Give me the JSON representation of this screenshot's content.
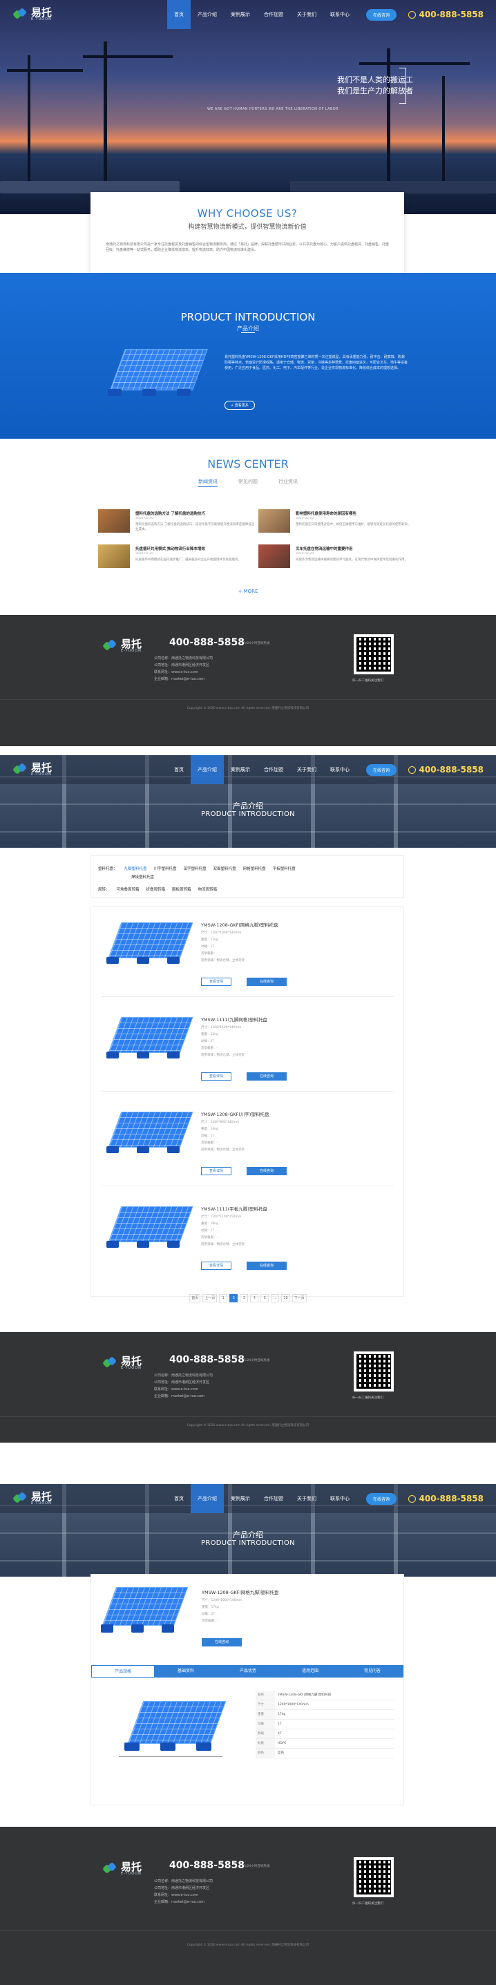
{
  "nav": {
    "logo_cn": "易托",
    "logo_en": "E-TUOON",
    "items": [
      "首页",
      "产品介绍",
      "案例展示",
      "合作加盟",
      "关于我们",
      "联系中心"
    ],
    "active": 0,
    "button": "在线咨询",
    "phone": "400-888-5858"
  },
  "hero": {
    "line1": "我们不是人类的搬运工",
    "line2": "我们是生产力的解放者",
    "line3": "WE ARE NOT HUMAN PORTERS WE ARE THE LIBERATION OF LABOR"
  },
  "why": {
    "title": "WHY CHOOSE US?",
    "subtitle": "构建智慧物流新模式，提供智慧物流新价值",
    "body": "南通托之物流科技有限公司是一家专注托盘租赁及托盘销售的综合型物流服务商。通过「易托」品牌，深耕托盘循环共用业务，以共享托盘为核心，为客户提供托盘租赁、托盘销售、托盘回收、托盘维修等一站式服务，帮助企业降低物流成本、提升物流效率，助力中国物流标准化建设。"
  },
  "product": {
    "title": "PRODUCT INTRODUCTION",
    "subtitle": "产品介绍",
    "desc": "易托塑料托盘YMSW-1208-GKF采用HDPE高密度聚乙烯材质一次注塑成型，具有承重能力强、耐冲击、耐腐蚀、防潮防霉等特点，表面设计防滑纹路，适用于仓储、物流、货架、冷链等多种场景。托盘四面进叉，可配合叉车、地牛等设备使用，广泛应用于食品、医药、化工、电子、汽车配件等行业，是企业实现物流标准化、降低综合成本的理想选择。",
    "more": "+ 查看更多"
  },
  "news": {
    "title": "NEWS CENTER",
    "tabs": [
      "新闻资讯",
      "常见问题",
      "行业资讯"
    ],
    "active": 0,
    "items": [
      {
        "title": "塑料托盘的选购方法 了解托盘的选购技巧",
        "date": "2020-02-20",
        "desc": "塑料托盘的选购方法 了解托盘的选购技巧，选对托盘不仅能够提升物流效率还能降低企业成本。"
      },
      {
        "title": "影响塑料托盘使用寿命的原因有哪些",
        "date": "2020-02-20",
        "desc": "塑料托盘在日常使用过程中，如何正确使用与维护，能够有效延长托盘的使用寿命。"
      },
      {
        "title": "托盘循环共用模式 推动物流行业降本增效",
        "date": "2020-02-20",
        "desc": "托盘循环共用模式在国内逐步推广，越来越多的企业开始使用共享托盘服务。"
      },
      {
        "title": "叉车托盘在物流运输中的重要作用",
        "date": "2020-02-20",
        "desc": "托盘作为物流运输中重要的集装单元器具，在现代物流中发挥着举足轻重的作用。"
      }
    ],
    "more": "+ MORE"
  },
  "footer": {
    "phone": "400-888-5858",
    "hours": "7x24小时咨询热线",
    "addr": [
      "公司名称：南通托之物流科技有限公司",
      "公司地址：南通市港闸区经济开发区",
      "联系网址：www.e-tuo.com",
      "企业邮箱：market@e-tuo.com"
    ],
    "qr": "扫一扫二维码关注我们",
    "copy": "Copyright © 2020 www.e-tuo.com All rights reserved. 南通托之物流科技有限公司"
  },
  "banner": {
    "title": "产品介绍",
    "en": "PRODUCT INTRODUCTION"
  },
  "filter": {
    "label1": "塑料托盘：",
    "opts1": [
      "九脚塑料托盘",
      "川字塑料托盘",
      "田字塑料托盘",
      "双面塑料托盘",
      "网格塑料托盘",
      "平板塑料托盘",
      "焊接塑料托盘"
    ],
    "label2": "周转：",
    "opts2": [
      "可堆叠周转箱",
      "折叠周转箱",
      "围板周转箱",
      "物流周转箱"
    ]
  },
  "list": {
    "items": [
      {
        "name": "YMSW-1208-GKF(网格九脚)塑料托盘",
        "size": "尺寸：1200*1000*140mm",
        "weight": "重量：17kg",
        "load": "动载：1T",
        "rack": "货架载重：-",
        "desc": "适用领域：物流仓储、立体货架",
        "btn1": "查看详情",
        "btn2": "在线咨询"
      },
      {
        "name": "YMSW-1111(九脚网格)塑料托盘",
        "size": "尺寸：1100*1100*140mm",
        "weight": "重量：15kg",
        "load": "动载：1T",
        "rack": "货架载重：-",
        "desc": "适用领域：物流仓储、立体货架",
        "btn1": "查看详情",
        "btn2": "在线咨询"
      },
      {
        "name": "YMSW-1208-GKF(川字)塑料托盘",
        "size": "尺寸：1200*800*140mm",
        "weight": "重量：14kg",
        "load": "动载：1T",
        "rack": "货架载重：-",
        "desc": "适用领域：物流仓储、立体货架",
        "btn1": "查看详情",
        "btn2": "在线咨询"
      },
      {
        "name": "YMSW-1111(平板九脚)塑料托盘",
        "size": "尺寸：1100*1100*150mm",
        "weight": "重量：16kg",
        "load": "动载：1T",
        "rack": "货架载重：-",
        "desc": "适用领域：物流仓储、立体货架",
        "btn1": "查看详情",
        "btn2": "在线咨询"
      }
    ]
  },
  "pager": [
    "首页",
    "上一页",
    "1",
    "2",
    "3",
    "4",
    "5",
    "…",
    "20",
    "下一页"
  ],
  "detail": {
    "name": "YMSW-1208-GKF(网格九脚)塑料托盘",
    "size": "尺寸：1200*1000*140mm",
    "weight": "重量：17kg",
    "load": "动载：1T",
    "rack": "货架载重：-",
    "btn": "在线咨询",
    "tabs": [
      "产品规格",
      "基础资料",
      "产品优势",
      "适用范围",
      "常见问答"
    ],
    "spec": [
      [
        "名称",
        "YMSW-1208-GKF(网格九脚)塑料托盘"
      ],
      [
        "尺寸",
        "1200*1000*140mm"
      ],
      [
        "重量",
        "17kg"
      ],
      [
        "动载",
        "1T"
      ],
      [
        "静载",
        "4T"
      ],
      [
        "材质",
        "HDPE"
      ],
      [
        "颜色",
        "蓝色"
      ]
    ]
  }
}
